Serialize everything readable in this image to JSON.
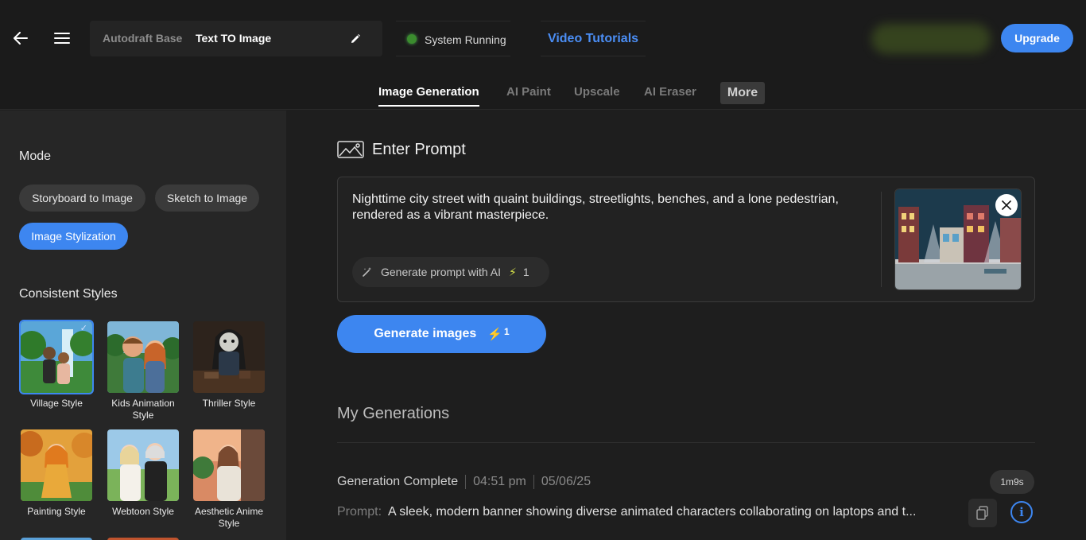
{
  "header": {
    "project_base": "Autodraft Base",
    "project_name": "Text TO Image",
    "status_text": "System Running",
    "video_tutorials": "Video Tutorials",
    "upgrade_label": "Upgrade"
  },
  "tabs": [
    {
      "label": "Image Generation",
      "active": true
    },
    {
      "label": "AI Paint",
      "active": false
    },
    {
      "label": "Upscale",
      "active": false
    },
    {
      "label": "AI Eraser",
      "active": false
    },
    {
      "label": "More",
      "active": false
    }
  ],
  "sidebar": {
    "mode_title": "Mode",
    "modes": [
      {
        "label": "Storyboard to Image",
        "active": false
      },
      {
        "label": "Sketch to Image",
        "active": false
      },
      {
        "label": "Image Stylization",
        "active": true
      }
    ],
    "styles_title": "Consistent Styles",
    "styles": [
      {
        "label": "Village Style",
        "selected": true
      },
      {
        "label": "Kids Animation Style",
        "selected": false
      },
      {
        "label": "Thriller Style",
        "selected": false
      },
      {
        "label": "Painting Style",
        "selected": false
      },
      {
        "label": "Webtoon Style",
        "selected": false
      },
      {
        "label": "Aesthetic Anime Style",
        "selected": false
      }
    ]
  },
  "prompt": {
    "section_title": "Enter Prompt",
    "text": "Nighttime city street with quaint buildings, streetlights, benches, and a lone pedestrian, rendered as a vibrant masterpiece.",
    "gen_ai_label": "Generate prompt with AI",
    "gen_ai_cost": "1",
    "generate_label": "Generate images",
    "generate_cost": "1"
  },
  "generations": {
    "title": "My Generations",
    "items": [
      {
        "status": "Generation Complete",
        "time": "04:51 pm",
        "date": "05/06/25",
        "duration": "1m9s",
        "prompt_label": "Prompt:",
        "prompt": "A sleek, modern banner showing diverse animated characters collaborating on laptops and t..."
      }
    ]
  },
  "colors": {
    "accent": "#3d86f0",
    "status_green": "#3b8c2e",
    "bolt_yellow": "#d7e34a"
  }
}
